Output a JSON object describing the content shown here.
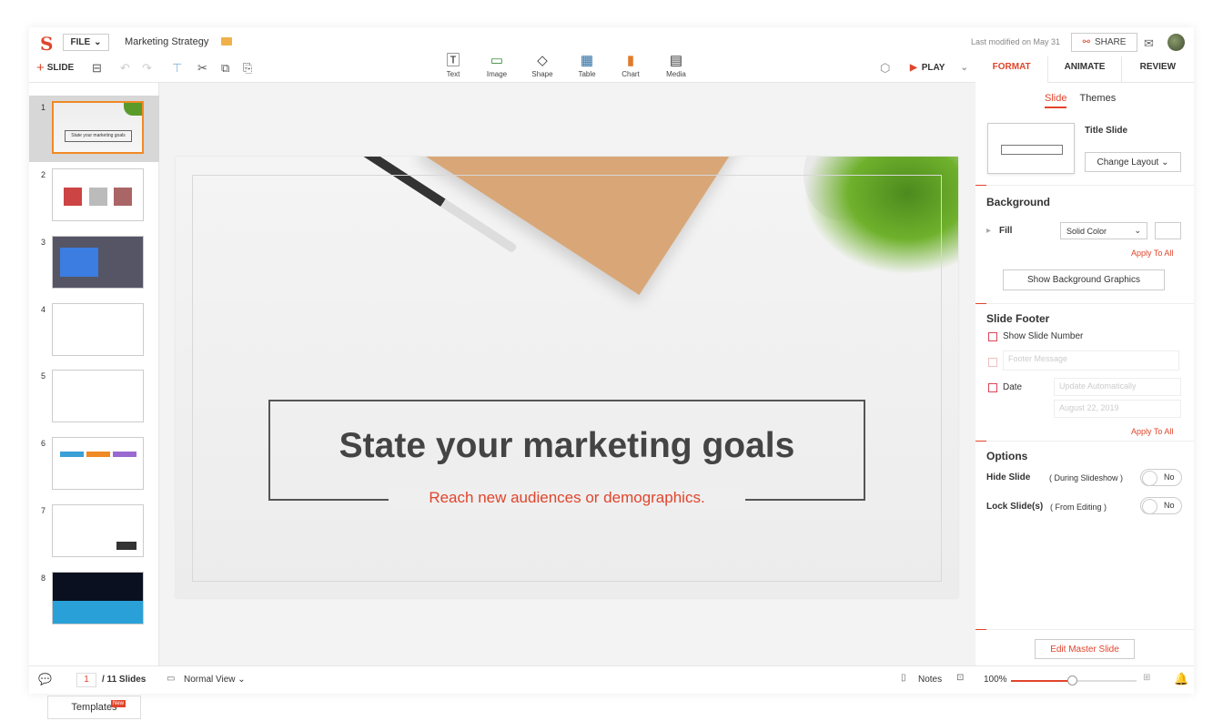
{
  "header": {
    "file_label": "FILE",
    "doc_title": "Marketing Strategy",
    "last_modified": "Last modified on May 31",
    "share_label": "SHARE"
  },
  "toolbar": {
    "add_slide": "SLIDE",
    "insert": [
      {
        "label": "Text",
        "icon": "T"
      },
      {
        "label": "Image",
        "icon": "▭"
      },
      {
        "label": "Shape",
        "icon": "◇"
      },
      {
        "label": "Table",
        "icon": "▦"
      },
      {
        "label": "Chart",
        "icon": "▮"
      },
      {
        "label": "Media",
        "icon": "▤"
      }
    ],
    "play_label": "PLAY"
  },
  "tabs": [
    "FORMAT",
    "ANIMATE",
    "REVIEW"
  ],
  "slides": {
    "numbers": [
      "1",
      "2",
      "3",
      "4",
      "5",
      "6",
      "7",
      "8"
    ],
    "thumb1_text": "State your marketing goals",
    "templates_label": "Templates",
    "new_badge": "New"
  },
  "slide": {
    "title": "State your marketing goals",
    "subtitle": "Reach new audiences or demographics."
  },
  "panel": {
    "sub_tabs": [
      "Slide",
      "Themes"
    ],
    "layout_name": "Title Slide",
    "change_layout": "Change Layout",
    "background_heading": "Background",
    "fill_label": "Fill",
    "fill_value": "Solid Color",
    "apply_all": "Apply To All",
    "show_bg_graphics": "Show Background Graphics",
    "footer_heading": "Slide Footer",
    "show_slide_number": "Show Slide Number",
    "footer_placeholder": "Footer Message",
    "date_label": "Date",
    "date_mode": "Update Automatically",
    "date_value": "August 22, 2019",
    "options_heading": "Options",
    "hide_slide": "Hide Slide",
    "hide_slide_note": "( During Slideshow )",
    "lock_slide": "Lock Slide(s)",
    "lock_slide_note": "( From Editing )",
    "toggle_value": "No",
    "edit_master": "Edit Master Slide"
  },
  "status": {
    "current_page": "1",
    "total": "/ 11 Slides",
    "view": "Normal View",
    "notes": "Notes",
    "zoom": "100%",
    "zoom_percent": 45
  },
  "colors": {
    "accent": "#e0452c",
    "selection": "#f08a24"
  }
}
